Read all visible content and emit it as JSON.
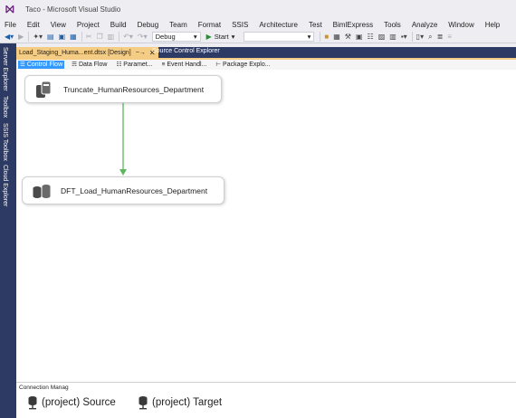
{
  "window": {
    "title": "Taco - Microsoft Visual Studio"
  },
  "menu": [
    "File",
    "Edit",
    "View",
    "Project",
    "Build",
    "Debug",
    "Team",
    "Format",
    "SSIS",
    "Architecture",
    "Test",
    "BimlExpress",
    "Tools",
    "Analyze",
    "Window",
    "Help"
  ],
  "toolbar": {
    "config_value": "Debug",
    "start_label": "Start"
  },
  "sidebar": {
    "tabs": [
      "Server Explorer",
      "Toolbox",
      "SSIS Toolbox",
      "Cloud Explorer"
    ]
  },
  "document_tabs": {
    "active": "Load_Staging_Huma...ent.dtsx [Design]",
    "other": "Source Control Explorer"
  },
  "designer_tabs": [
    "Control Flow",
    "Data Flow",
    "Paramet...",
    "Event Handl...",
    "Package Explo..."
  ],
  "tasks": [
    {
      "label": "Truncate_HumanResources_Department",
      "icon": "execute-sql-task-icon"
    },
    {
      "label": "DFT_Load_HumanResources_Department",
      "icon": "data-flow-task-icon"
    }
  ],
  "precedence_color": "#5cb85c",
  "connection_managers": {
    "title": "Connection Manag",
    "items": [
      "(project) Source",
      "(project) Target"
    ]
  },
  "colors": {
    "accent": "#68217a",
    "tab_active": "#f5cc84",
    "sidebar": "#2d3a63",
    "selection": "#3399ff"
  }
}
